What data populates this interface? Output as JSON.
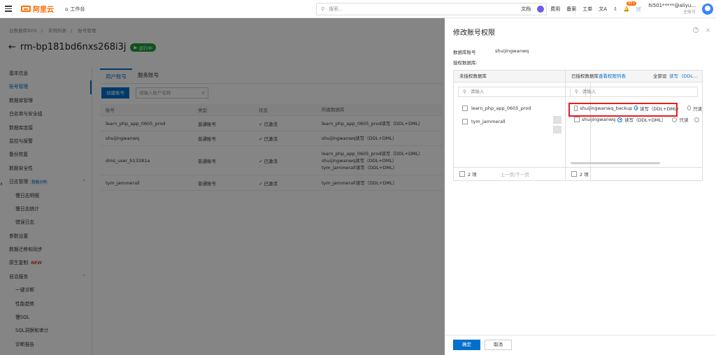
{
  "topbar": {
    "logo": "阿里云",
    "workbench": "工作台",
    "search_placeholder": "搜索...",
    "nav": [
      "文档",
      "费用",
      "备案",
      "工单"
    ],
    "badge": "99+",
    "account": "hi501*****@aliyu...",
    "account_role": "主账号"
  },
  "breadcrumb": [
    "云数据库RDS",
    "实例列表",
    "账号管理"
  ],
  "page_title": "rm-bp181bd6nxs268i3j",
  "status_badge": "运行中",
  "sidebar": {
    "items": [
      {
        "label": "基本信息"
      },
      {
        "label": "账号管理"
      },
      {
        "label": "数据库管理"
      },
      {
        "label": "白名单与安全组"
      },
      {
        "label": "数据库连接"
      },
      {
        "label": "监控与报警"
      },
      {
        "label": "备份恢复"
      },
      {
        "label": "数据安全性"
      },
      {
        "label": "日志管理",
        "tag": "智能分析"
      },
      {
        "label": "慢日志明细"
      },
      {
        "label": "慢日志统计"
      },
      {
        "label": "错误日志"
      },
      {
        "label": "参数设置"
      },
      {
        "label": "数据迁移和同步"
      },
      {
        "label": "原生复制",
        "tag": "NEW"
      },
      {
        "label": "自治服务"
      },
      {
        "label": "一键诊断"
      },
      {
        "label": "性能趋势"
      },
      {
        "label": "慢SQL"
      },
      {
        "label": "SQL洞察和审计"
      },
      {
        "label": "诊断报告"
      }
    ]
  },
  "tabs": [
    "用户账号",
    "服务账号"
  ],
  "create_button": "创建账号",
  "user_filter_placeholder": "请输入账户名称",
  "table": {
    "headers": [
      "账号",
      "类型",
      "状态",
      "所属数据库"
    ],
    "rows": [
      {
        "account": "learn_php_app_0605_prod",
        "type": "普通账号",
        "status": "已激活",
        "dbs": [
          "learn_php_app_0605_prod读写（DDL+DML）"
        ]
      },
      {
        "account": "shuijingwanwq",
        "type": "普通账号",
        "status": "已激活",
        "dbs": [
          "shuijingwanwq读写（DDL+DML）"
        ]
      },
      {
        "account": "dms_user_b13281a",
        "type": "普通账号",
        "status": "已激活",
        "dbs": [
          "learn_php_app_0605_prod读写（DDL+DML）",
          "shuijingwanwq读写（DDL+DML）",
          "tym_jammerall读写（DDL+DML）"
        ]
      },
      {
        "account": "tym_jammerall",
        "type": "普通账号",
        "status": "已激活",
        "dbs": [
          "tym_jammerall读写（DDL+DML）"
        ]
      }
    ]
  },
  "drawer": {
    "title": "修改账号权限",
    "account_label": "数据库账号",
    "account_value": "shuijingwanwq",
    "auth_db_label": "授权数据库:",
    "left_panel": {
      "title": "未授权数据库",
      "search_placeholder": "请输入",
      "items": [
        "learn_php_app_0605_prod",
        "tym_jammerall"
      ],
      "count": "2 项",
      "pager": "上一页/下一页"
    },
    "right_panel": {
      "title": "已授权数据库",
      "link": "查看权限列表",
      "all_set": "全部设",
      "all_rw": "读写",
      "all_ddl": "(DDL...",
      "search_placeholder": "请输入",
      "items": [
        {
          "name": "shuijingwanwq_backup",
          "rw": "读写（DDL+DML）",
          "ro": "只读"
        },
        {
          "name": "shuijingwanwq",
          "rw": "读写（DDL+DML）",
          "ro": "只读"
        }
      ],
      "count": "2 项"
    },
    "ok": "确定",
    "cancel": "取消"
  }
}
